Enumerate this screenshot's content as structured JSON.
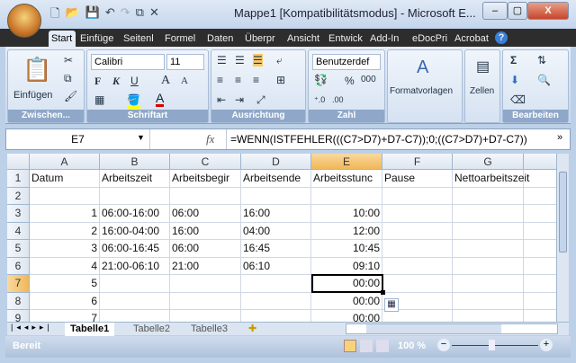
{
  "window": {
    "title": "Mappe1  [Kompatibilitätsmodus] - Microsoft E...",
    "minimize": "–",
    "maximize": "▢",
    "close": "X"
  },
  "qat": [
    "new-icon",
    "open-icon",
    "save-icon",
    "undo-icon",
    "redo-icon",
    "copy-icon",
    "cut-icon"
  ],
  "tabs": [
    "Start",
    "Einfüge",
    "Seitenl",
    "Formel",
    "Daten",
    "Überpr",
    "Ansicht",
    "Entwick",
    "Add-In",
    "eDocPri",
    "Acrobat"
  ],
  "ribbon": {
    "clipboard": {
      "label": "Zwischen...",
      "paste": "Einfügen"
    },
    "font": {
      "label": "Schriftart",
      "name": "Calibri",
      "size": "11",
      "bold": "F",
      "italic": "K",
      "underline": "U",
      "grow": "A",
      "shrink": "A",
      "font_color": "A"
    },
    "alignment": {
      "label": "Ausrichtung"
    },
    "number": {
      "label": "Zahl",
      "format": "Benutzerdef",
      "percent": "%",
      "thousands": "000"
    },
    "styles": {
      "label": "Formatvorlagen"
    },
    "cells": {
      "label": "Zellen"
    },
    "editing": {
      "label": "Bearbeiten",
      "sum": "Σ"
    }
  },
  "formula_bar": {
    "name_box": "E7",
    "fx": "fx",
    "formula": "=WENN(ISTFEHLER(((C7>D7)+D7-C7));0;((C7>D7)+D7-C7))"
  },
  "columns": [
    "A",
    "B",
    "C",
    "D",
    "E",
    "F",
    "G"
  ],
  "selected_column": "E",
  "selected_row": "7",
  "rows": [
    {
      "n": "1",
      "A": "Datum",
      "B": "Arbeitszeit",
      "C": "Arbeitsbegir",
      "D": "Arbeitsende",
      "E": "Arbeitsstunc",
      "F": "Pause",
      "G": "Nettoarbeitszeit"
    },
    {
      "n": "2",
      "A": "",
      "B": "",
      "C": "",
      "D": "",
      "E": "",
      "F": "",
      "G": ""
    },
    {
      "n": "3",
      "A": "1",
      "B": "06:00-16:00",
      "C": "06:00",
      "D": "16:00",
      "E": "10:00",
      "F": "",
      "G": ""
    },
    {
      "n": "4",
      "A": "2",
      "B": "16:00-04:00",
      "C": "16:00",
      "D": "04:00",
      "E": "12:00",
      "F": "",
      "G": ""
    },
    {
      "n": "5",
      "A": "3",
      "B": "06:00-16:45",
      "C": "06:00",
      "D": "16:45",
      "E": "10:45",
      "F": "",
      "G": ""
    },
    {
      "n": "6",
      "A": "4",
      "B": "21:00-06:10",
      "C": "21:00",
      "D": "06:10",
      "E": "09:10",
      "F": "",
      "G": ""
    },
    {
      "n": "7",
      "A": "5",
      "B": "",
      "C": "",
      "D": "",
      "E": "00:00",
      "F": "",
      "G": ""
    },
    {
      "n": "8",
      "A": "6",
      "B": "",
      "C": "",
      "D": "",
      "E": "00:00",
      "F": "",
      "G": ""
    },
    {
      "n": "9",
      "A": "7",
      "B": "",
      "C": "",
      "D": "",
      "E": "00:00",
      "F": "",
      "G": ""
    }
  ],
  "sheets": [
    "Tabelle1",
    "Tabelle2",
    "Tabelle3"
  ],
  "active_sheet": "Tabelle1",
  "status": {
    "text": "Bereit",
    "zoom": "100 %"
  }
}
